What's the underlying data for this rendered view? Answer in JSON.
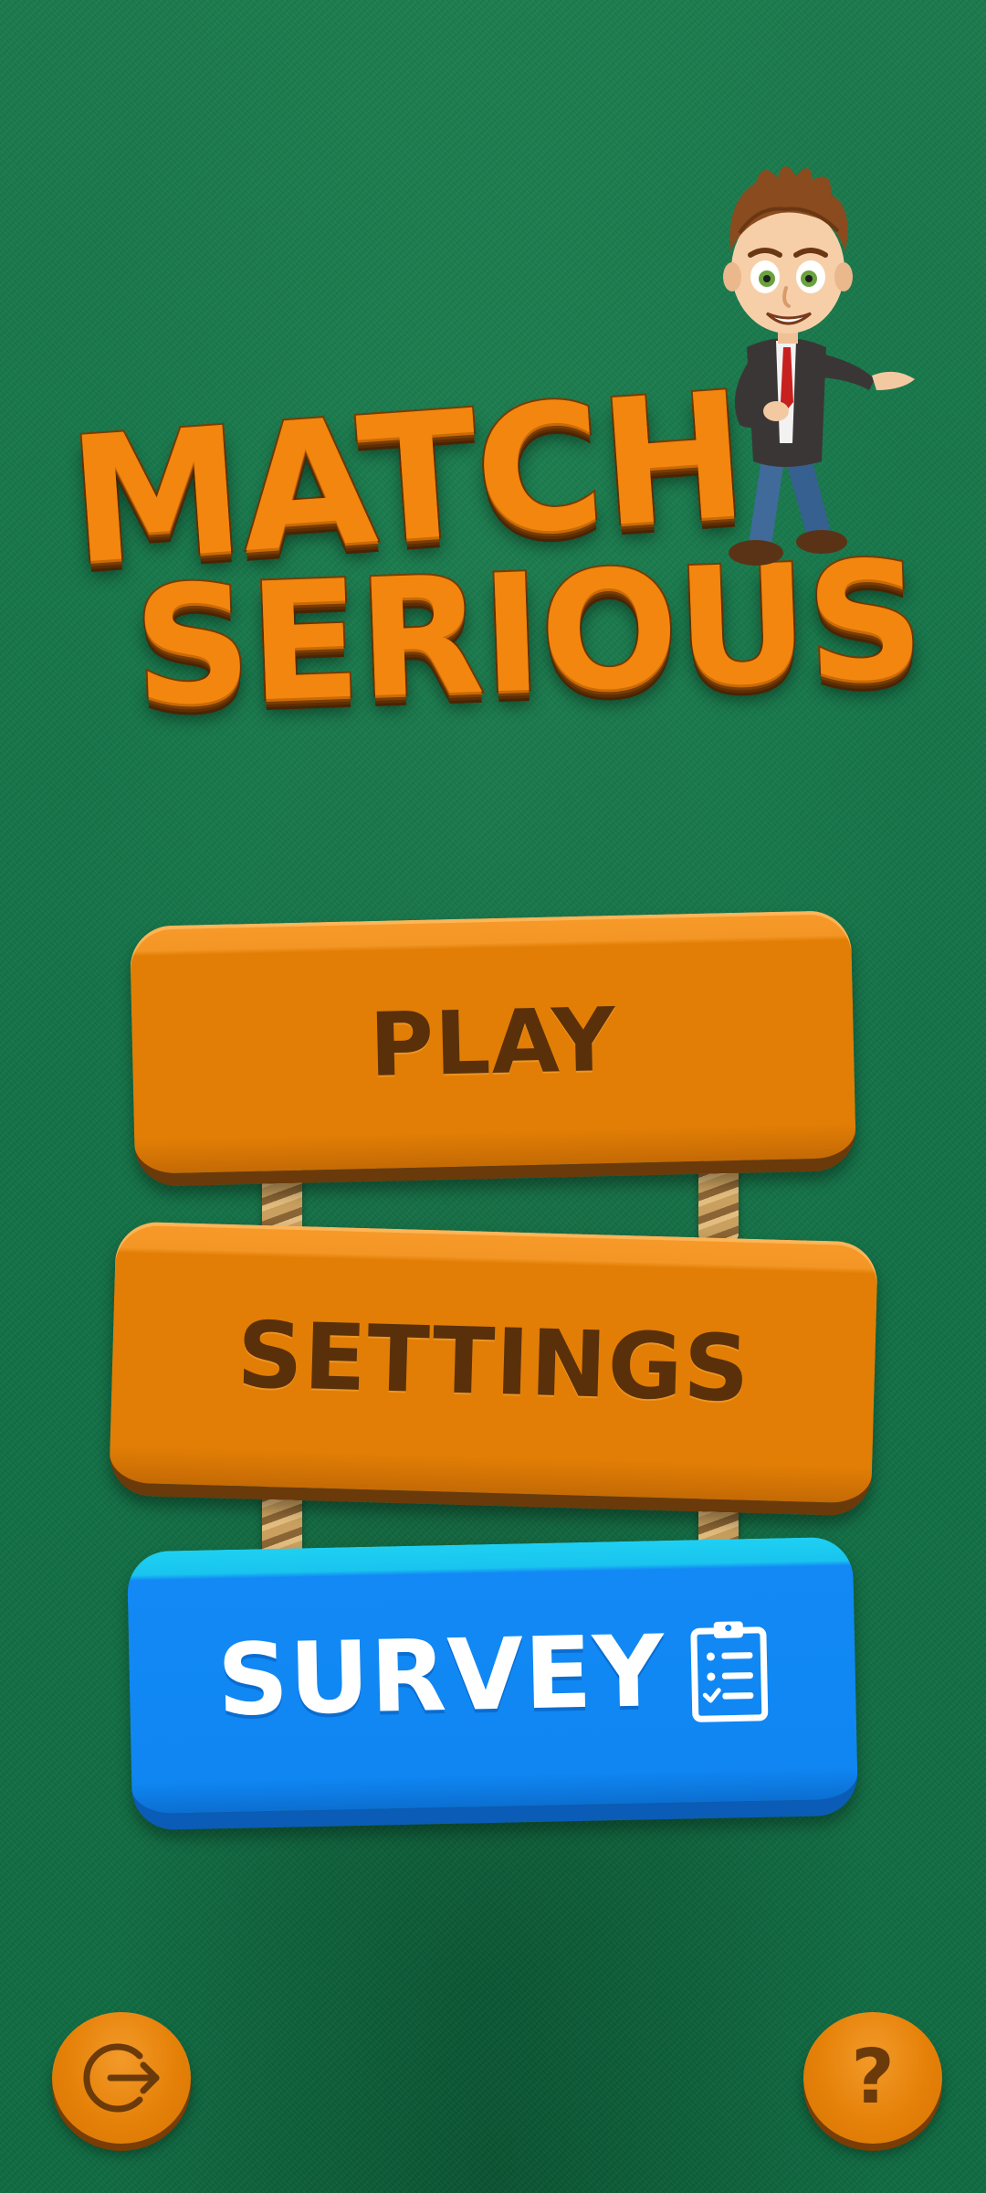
{
  "title": {
    "line1": "MATCH",
    "line2": "SERIOUS"
  },
  "menu": {
    "play_label": "PLAY",
    "settings_label": "SETTINGS",
    "survey_label": "SURVEY"
  },
  "corner_buttons": {
    "exit_icon": "exit-icon",
    "help_label": "?"
  },
  "icons": {
    "survey": "clipboard-checklist-icon",
    "exit": "arrow-out-circle-icon"
  },
  "colors": {
    "background": "#137247",
    "orange": "#e27e05",
    "orange_dark": "#6b3a0a",
    "blue": "#0f86f2",
    "blue_top": "#1fd0f2"
  }
}
